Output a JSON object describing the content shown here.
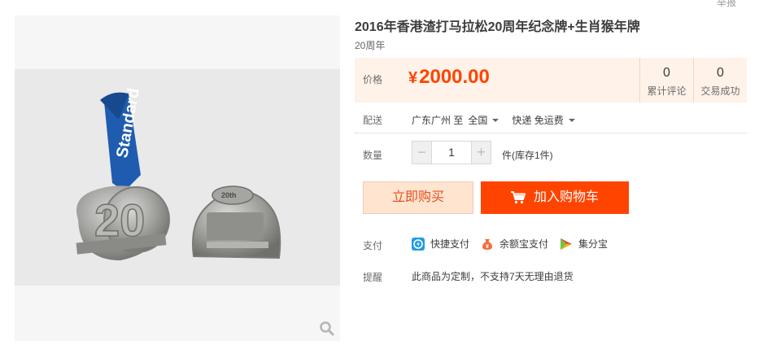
{
  "header": {
    "report_link": "举报"
  },
  "gallery": {
    "zoom_icon": "search-icon"
  },
  "product": {
    "title": "2016年香港渣打马拉松20周年纪念牌+生肖猴年牌",
    "subtitle": "20周年"
  },
  "price": {
    "label": "价格",
    "currency": "¥",
    "amount": "2000.00",
    "accent_color": "#ff4400"
  },
  "stats": [
    {
      "count": "0",
      "label": "累计评论"
    },
    {
      "count": "0",
      "label": "交易成功"
    }
  ],
  "delivery": {
    "label": "配送",
    "origin": "广东广州 至",
    "destination": "全国",
    "shipping": "快递 免运费"
  },
  "quantity": {
    "label": "数量",
    "minus": "−",
    "plus": "+",
    "value": "1",
    "stock": "件(库存1件)"
  },
  "actions": {
    "buy_now": "立即购买",
    "add_to_cart": "加入购物车"
  },
  "payment": {
    "label": "支付",
    "methods": [
      "快捷支付",
      "余额宝支付",
      "集分宝"
    ]
  },
  "notice": {
    "label": "提醒",
    "text": "此商品为定制，不支持7天无理由退货"
  }
}
